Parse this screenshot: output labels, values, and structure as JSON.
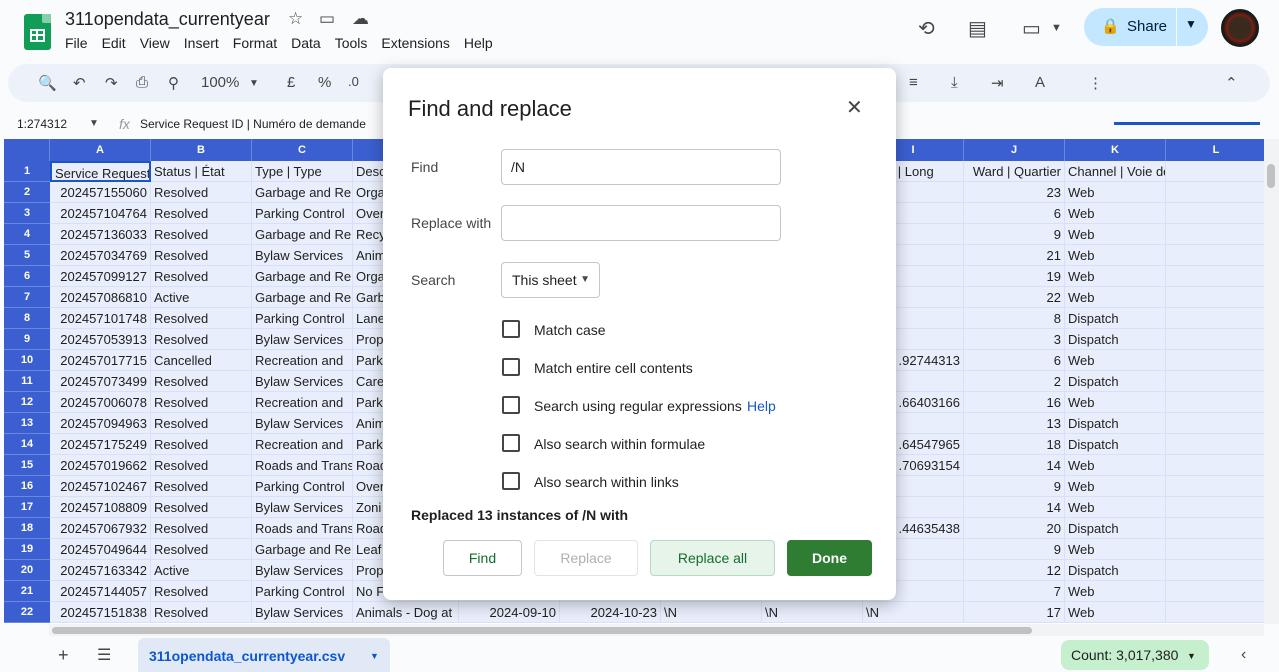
{
  "app": {
    "doc_title": "311opendata_currentyear",
    "menu": [
      "File",
      "Edit",
      "View",
      "Insert",
      "Format",
      "Data",
      "Tools",
      "Extensions",
      "Help"
    ],
    "share_label": "Share"
  },
  "toolbar": {
    "zoom": "100%",
    "currency": "£",
    "percent": "%",
    "decimal": ".0"
  },
  "formula_bar": {
    "name_box": "1:274312",
    "fx": "fx",
    "content": "Service Request ID | Numéro de demande"
  },
  "grid": {
    "columns": [
      "A",
      "B",
      "C",
      "",
      "",
      "",
      "",
      "",
      "I",
      "J",
      "K",
      "L"
    ],
    "rows": [
      {
        "n": "1",
        "a": "Service Request",
        "b": "Status | État",
        "c": "Type | Type",
        "d": "Desc",
        "i": "itude | Long",
        "j": "Ward | Quartier",
        "k": "Channel | Voie de service"
      },
      {
        "n": "2",
        "a": "202457155060",
        "b": "Resolved",
        "c": "Garbage and Re",
        "d": "Orga",
        "i": "",
        "j": "23",
        "k": "Web"
      },
      {
        "n": "3",
        "a": "202457104764",
        "b": "Resolved",
        "c": "Parking Control",
        "d": "Over",
        "i": "",
        "j": "6",
        "k": "Web"
      },
      {
        "n": "4",
        "a": "202457136033",
        "b": "Resolved",
        "c": "Garbage and Re",
        "d": "Recy",
        "i": "",
        "j": "9",
        "k": "Web"
      },
      {
        "n": "5",
        "a": "202457034769",
        "b": "Resolved",
        "c": "Bylaw Services",
        "d": "Anim",
        "i": "",
        "j": "21",
        "k": "Web"
      },
      {
        "n": "6",
        "a": "202457099127",
        "b": "Resolved",
        "c": "Garbage and Re",
        "d": "Orga",
        "i": "",
        "j": "19",
        "k": "Web"
      },
      {
        "n": "7",
        "a": "202457086810",
        "b": "Active",
        "c": "Garbage and Re",
        "d": "Garb",
        "i": "",
        "j": "22",
        "k": "Web"
      },
      {
        "n": "8",
        "a": "202457101748",
        "b": "Resolved",
        "c": "Parking Control",
        "d": "Lane",
        "i": "",
        "j": "8",
        "k": "Dispatch"
      },
      {
        "n": "9",
        "a": "202457053913",
        "b": "Resolved",
        "c": "Bylaw Services",
        "d": "Prop",
        "i": "",
        "j": "3",
        "k": "Dispatch"
      },
      {
        "n": "10",
        "a": "202457017715",
        "b": "Cancelled",
        "c": "Recreation and",
        "d": "Park",
        "i": ".92744313",
        "j": "6",
        "k": "Web"
      },
      {
        "n": "11",
        "a": "202457073499",
        "b": "Resolved",
        "c": "Bylaw Services",
        "d": "Care",
        "i": "",
        "j": "2",
        "k": "Dispatch"
      },
      {
        "n": "12",
        "a": "202457006078",
        "b": "Resolved",
        "c": "Recreation and",
        "d": "Park",
        "i": ".66403166",
        "j": "16",
        "k": "Web"
      },
      {
        "n": "13",
        "a": "202457094963",
        "b": "Resolved",
        "c": "Bylaw Services",
        "d": "Anim",
        "i": "",
        "j": "13",
        "k": "Dispatch"
      },
      {
        "n": "14",
        "a": "202457175249",
        "b": "Resolved",
        "c": "Recreation and",
        "d": "Park",
        "i": ".64547965",
        "j": "18",
        "k": "Dispatch"
      },
      {
        "n": "15",
        "a": "202457019662",
        "b": "Resolved",
        "c": "Roads and Trans",
        "d": "Road",
        "i": ".70693154",
        "j": "14",
        "k": "Web"
      },
      {
        "n": "16",
        "a": "202457102467",
        "b": "Resolved",
        "c": "Parking Control",
        "d": "Over",
        "i": "",
        "j": "9",
        "k": "Web"
      },
      {
        "n": "17",
        "a": "202457108809",
        "b": "Resolved",
        "c": "Bylaw Services",
        "d": "Zoni",
        "i": "",
        "j": "14",
        "k": "Web"
      },
      {
        "n": "18",
        "a": "202457067932",
        "b": "Resolved",
        "c": "Roads and Trans",
        "d": "Road",
        "i": ".44635438",
        "j": "20",
        "k": "Dispatch"
      },
      {
        "n": "19",
        "a": "202457049644",
        "b": "Resolved",
        "c": "Garbage and Re",
        "d": "Leaf",
        "i": "",
        "j": "9",
        "k": "Web"
      },
      {
        "n": "20",
        "a": "202457163342",
        "b": "Active",
        "c": "Bylaw Services",
        "d": "Prop",
        "i": "",
        "j": "12",
        "k": "Dispatch"
      },
      {
        "n": "21",
        "a": "202457144057",
        "b": "Resolved",
        "c": "Parking Control",
        "d": "No F",
        "i": "",
        "j": "7",
        "k": "Web"
      },
      {
        "n": "22",
        "a": "202457151838",
        "b": "Resolved",
        "c": "Bylaw Services",
        "d": "Animals - Dog at",
        "e": "2024-09-10",
        "f": "2024-10-23",
        "g": "\\N",
        "h": "\\N",
        "i": "\\N",
        "j": "17",
        "k": "Web"
      }
    ]
  },
  "sheet_tab": "311opendata_currentyear.csv",
  "count": "Count: 3,017,380",
  "dialog": {
    "title": "Find and replace",
    "find_label": "Find",
    "find_value": "/N",
    "replace_label": "Replace with",
    "replace_value": "",
    "search_label": "Search",
    "search_value": "This sheet",
    "options": [
      {
        "label": "Match case",
        "checked": false
      },
      {
        "label": "Match entire cell contents",
        "checked": false
      },
      {
        "label": "Search using regular expressions",
        "checked": false
      },
      {
        "label": "Also search within formulae",
        "checked": false
      },
      {
        "label": "Also search within links",
        "checked": false
      }
    ],
    "help_label": "Help",
    "status": "Replaced 13 instances of /N with",
    "buttons": {
      "find": "Find",
      "replace": "Replace",
      "replace_all": "Replace all",
      "done": "Done"
    }
  }
}
